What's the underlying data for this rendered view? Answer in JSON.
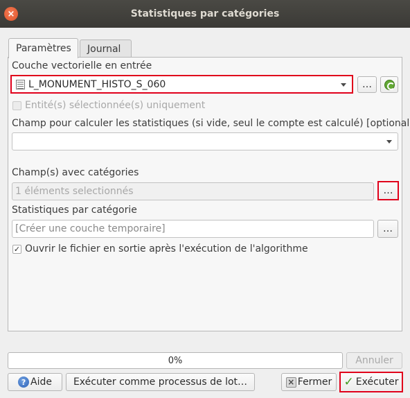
{
  "window": {
    "title": "Statistiques par catégories",
    "close_symbol": "×"
  },
  "tabs": [
    {
      "label": "Paramètres",
      "active": true
    },
    {
      "label": "Journal",
      "active": false
    }
  ],
  "form": {
    "input_layer": {
      "label": "Couche vectorielle en entrée",
      "value": "L_MONUMENT_HISTO_S_060",
      "browse_label": "…"
    },
    "selected_only": {
      "label": "Entité(s) sélectionnée(s) uniquement",
      "checked": false,
      "enabled": false
    },
    "stat_field": {
      "label": "Champ pour calculer les statistiques (si vide, seul le compte est calculé) [optional]",
      "value": ""
    },
    "category_fields": {
      "label": "Champ(s) avec catégories",
      "value": "1 éléments selectionnés",
      "browse_label": "…"
    },
    "output": {
      "label": "Statistiques par catégorie",
      "placeholder": "[Créer une couche temporaire]",
      "browse_label": "…"
    },
    "open_output": {
      "label": "Ouvrir le fichier en sortie après l'exécution de l'algorithme",
      "checked": true,
      "check_symbol": "✓"
    }
  },
  "progress": {
    "value": 0,
    "text": "0%",
    "cancel_label": "Annuler"
  },
  "buttons": {
    "help_symbol": "?",
    "help": "Aide",
    "batch": "Exécuter comme processus de lot…",
    "close_symbol": "×",
    "close": "Fermer",
    "run_symbol": "✓",
    "run": "Exécuter"
  },
  "icons": [
    "close-icon",
    "table-layer-icon",
    "chevron-down-icon",
    "refresh-icon",
    "help-icon",
    "cancel-icon",
    "check-icon"
  ],
  "colors": {
    "highlight_border": "#e0001b",
    "titlebar": "#3b3a36",
    "close_button": "#e0542a"
  }
}
